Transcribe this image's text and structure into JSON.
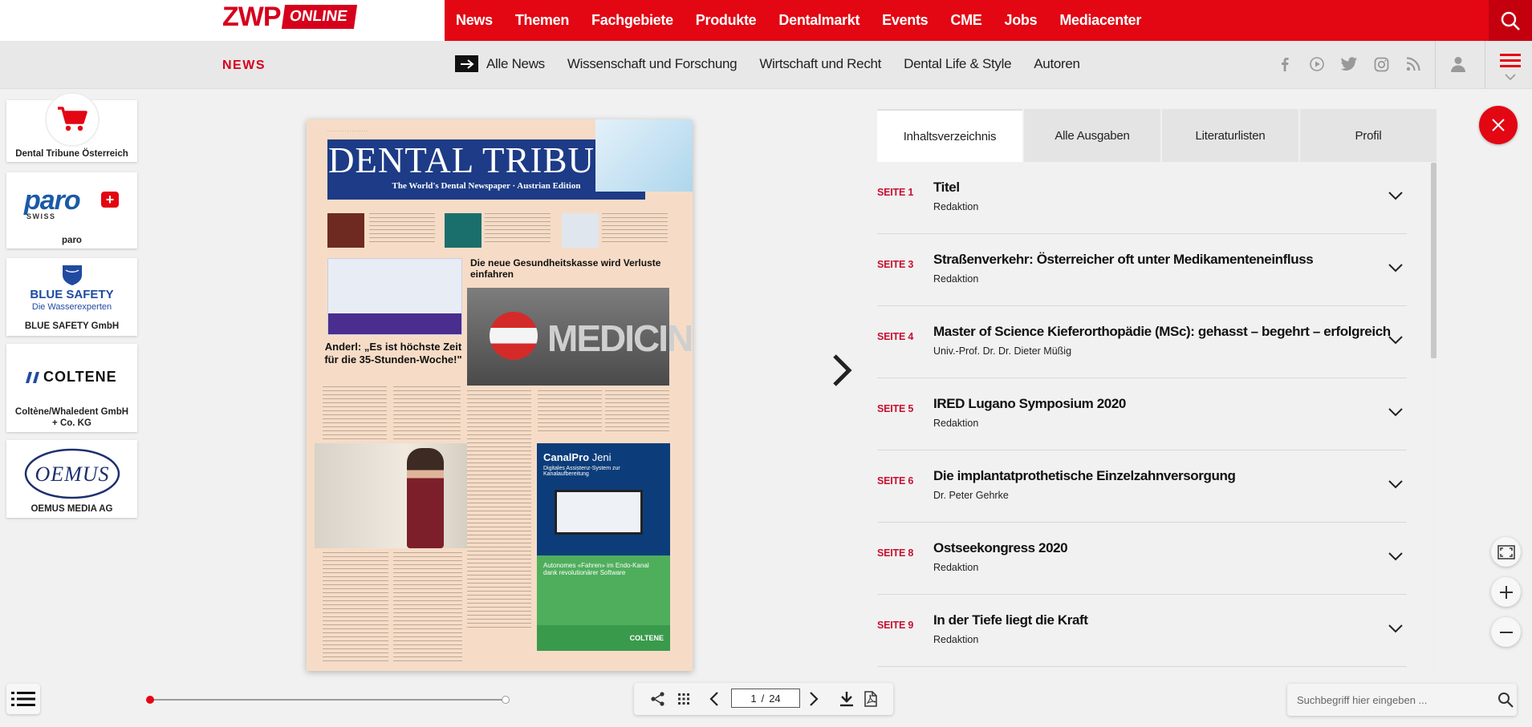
{
  "brand": {
    "logo_main": "ZWP",
    "logo_tag": "ONLINE"
  },
  "main_nav": [
    "News",
    "Themen",
    "Fachgebiete",
    "Produkte",
    "Dentalmarkt",
    "Events",
    "CME",
    "Jobs",
    "Mediacenter"
  ],
  "sub_bar": {
    "section_label": "NEWS",
    "links": [
      "Alle News",
      "Wissenschaft und Forschung",
      "Wirtschaft und Recht",
      "Dental Life & Style",
      "Autoren"
    ],
    "social_icons": [
      "facebook-icon",
      "youtube-icon",
      "twitter-icon",
      "instagram-icon",
      "rss-icon"
    ]
  },
  "sponsors": [
    {
      "name": "Dental Tribune Österreich",
      "logo": "cart-icon"
    },
    {
      "name": "paro",
      "logo_text": "paro",
      "logo_sub": "SWISS"
    },
    {
      "name": "BLUE SAFETY GmbH",
      "logo_text": "BLUE SAFETY",
      "logo_sub": "Die Wasserexperten"
    },
    {
      "name": "Coltène/Whaledent GmbH + Co. KG",
      "logo_text": "COLTENE"
    },
    {
      "name": "OEMUS MEDIA AG",
      "logo_text": "OEMUS"
    }
  ],
  "newspaper": {
    "masthead": "DENTAL TRIBUNE",
    "masthead_sub": "The World's Dental Newspaper · Austrian Edition",
    "headline_main": "Die neue Gesundheitskasse wird Verluste einfahren",
    "headline_side": "Anderl: „Es ist höchste Zeit für die 35-Stunden-Woche!\"",
    "image_word": "MEDICINE",
    "ad_title": "CanalPro",
    "ad_brand": "Jeni",
    "ad_subtitle": "Digitales Assistenz-System zur Kanalaufbereitung",
    "ad_green_text": "Autonomes «Fahren» im Endo-Kanal dank revolutionärer Software",
    "ad_footer": "COLTENE"
  },
  "panel": {
    "tabs": [
      {
        "label": "Inhaltsverzeichnis",
        "active": true
      },
      {
        "label": "Alle Ausgaben",
        "active": false
      },
      {
        "label": "Literaturlisten",
        "active": false
      },
      {
        "label": "Profil",
        "active": false
      }
    ],
    "toc": [
      {
        "page": "SEITE 1",
        "title": "Titel",
        "author": "Redaktion"
      },
      {
        "page": "SEITE 3",
        "title": "Straßenverkehr: Österreicher oft unter Medikamenteneinfluss",
        "author": "Redaktion"
      },
      {
        "page": "SEITE 4",
        "title": "Master of Science Kieferorthopädie (MSc): gehasst – begehrt – erfolgreich",
        "author": "Univ.-Prof. Dr. Dr. Dieter Müßig"
      },
      {
        "page": "SEITE 5",
        "title": "IRED Lugano Symposium 2020",
        "author": "Redaktion"
      },
      {
        "page": "SEITE 6",
        "title": "Die implantatprothetische Einzelzahnversorgung",
        "author": "Dr. Peter Gehrke"
      },
      {
        "page": "SEITE 8",
        "title": "Ostseekongress 2020",
        "author": "Redaktion"
      },
      {
        "page": "SEITE 9",
        "title": "In der Tiefe liegt die Kraft",
        "author": "Redaktion"
      }
    ]
  },
  "pager": {
    "current": "1",
    "separator": "/",
    "total": "24"
  },
  "search": {
    "placeholder": "Suchbegriff hier eingeben ..."
  },
  "colors": {
    "brand_red": "#e30613",
    "page_label_red": "#c8102e",
    "masthead_blue": "#1d3b86"
  }
}
